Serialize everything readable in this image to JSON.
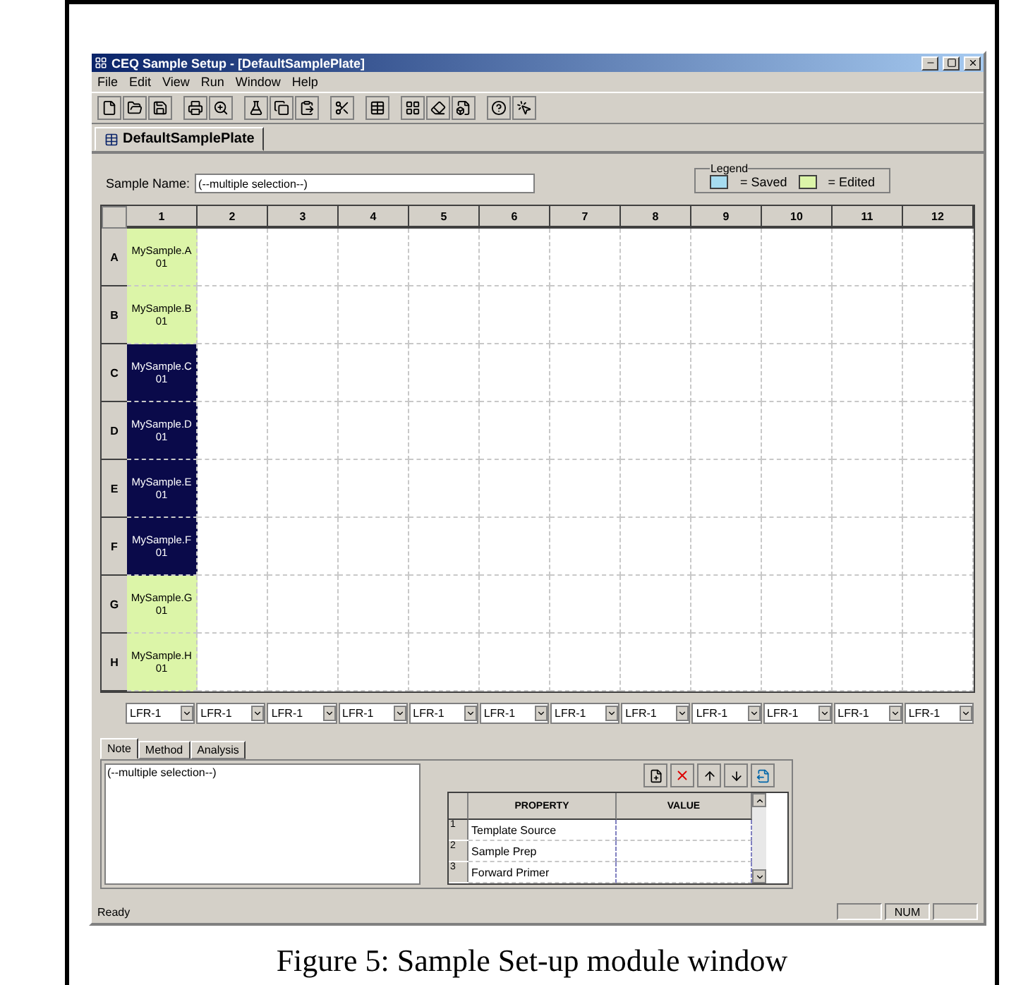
{
  "window": {
    "title": "CEQ Sample Setup - [DefaultSamplePlate]"
  },
  "menu": [
    "File",
    "Edit",
    "View",
    "Run",
    "Window",
    "Help"
  ],
  "document_tab": {
    "label": "DefaultSamplePlate",
    "selected": true
  },
  "sample_name": {
    "label": "Sample Name:",
    "value": "(--multiple selection--)"
  },
  "legend": {
    "title": "Legend",
    "items": [
      {
        "label": "= Saved",
        "color": "#a6dcf0"
      },
      {
        "label": "= Edited",
        "color": "#dcf5a8"
      }
    ]
  },
  "plate": {
    "columns": [
      "1",
      "2",
      "3",
      "4",
      "5",
      "6",
      "7",
      "8",
      "9",
      "10",
      "11",
      "12"
    ],
    "rows": [
      {
        "label": "A",
        "sample": "MySample.A01",
        "edited": true,
        "selected": false
      },
      {
        "label": "B",
        "sample": "MySample.B01",
        "edited": true,
        "selected": false
      },
      {
        "label": "C",
        "sample": "MySample.C01",
        "edited": true,
        "selected": true
      },
      {
        "label": "D",
        "sample": "MySample.D01",
        "edited": true,
        "selected": true
      },
      {
        "label": "E",
        "sample": "MySample.E01",
        "edited": true,
        "selected": true
      },
      {
        "label": "F",
        "sample": "MySample.F01",
        "edited": true,
        "selected": true
      },
      {
        "label": "G",
        "sample": "MySample.G01",
        "edited": true,
        "selected": false
      },
      {
        "label": "H",
        "sample": "MySample.H01",
        "edited": true,
        "selected": false
      }
    ],
    "methods": [
      "LFR-1",
      "LFR-1",
      "LFR-1",
      "LFR-1",
      "LFR-1",
      "LFR-1",
      "LFR-1",
      "LFR-1",
      "LFR-1",
      "LFR-1",
      "LFR-1",
      "LFR-1"
    ]
  },
  "bottom_tabs": [
    {
      "label": "Note",
      "selected": true
    },
    {
      "label": "Method",
      "selected": false
    },
    {
      "label": "Analysis",
      "selected": false
    }
  ],
  "note": {
    "value": "(--multiple selection--)"
  },
  "properties": {
    "columns": [
      "PROPERTY",
      "VALUE"
    ],
    "rows": [
      {
        "index": "1",
        "property": "Template Source",
        "value": ""
      },
      {
        "index": "2",
        "property": "Sample Prep",
        "value": ""
      },
      {
        "index": "3",
        "property": "Forward Primer",
        "value": ""
      }
    ]
  },
  "status_bar": {
    "message": "Ready",
    "indicator": "NUM"
  },
  "caption": "Figure 5: Sample Set-up module window"
}
